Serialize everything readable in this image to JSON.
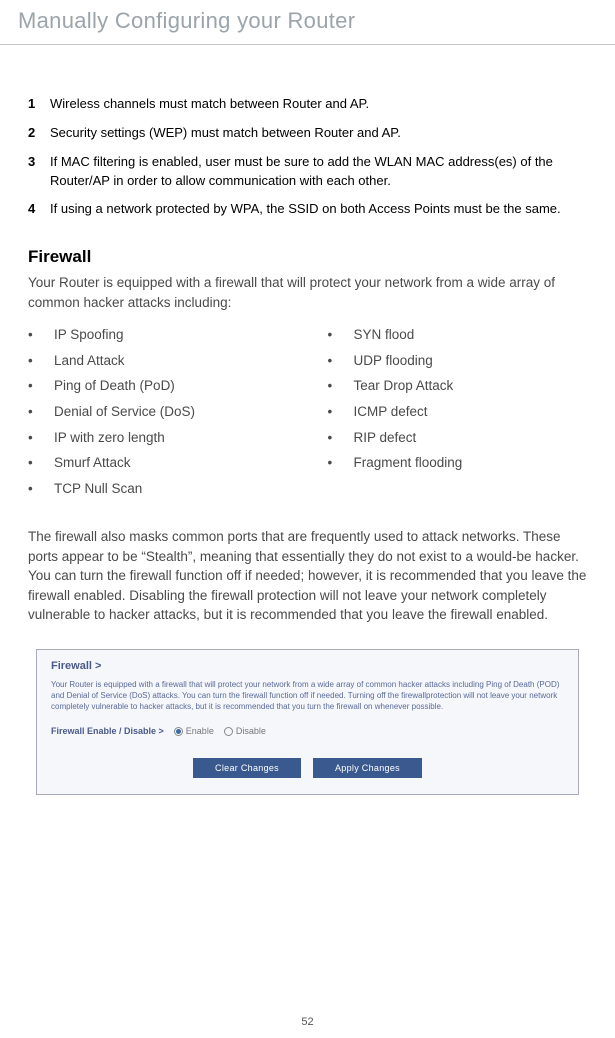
{
  "header": {
    "title": "Manually Configuring your Router"
  },
  "numbered": [
    {
      "num": "1",
      "text": "Wireless channels must match between Router and AP."
    },
    {
      "num": "2",
      "text": "Security settings (WEP) must match between Router and AP."
    },
    {
      "num": "3",
      "text": "If MAC filtering is enabled, user must be sure to add the WLAN MAC address(es) of the Router/AP in order to allow communication with each other."
    },
    {
      "num": "4",
      "text": "If using a network protected by WPA, the SSID on both Access Points must be the same."
    }
  ],
  "firewall": {
    "title": "Firewall",
    "intro": "Your Router is equipped with a firewall that will protect your network from a wide array of common hacker attacks including:",
    "left_items": [
      "IP Spoofing",
      "Land Attack",
      "Ping of Death (PoD)",
      "Denial of Service (DoS)",
      "IP with zero length",
      "Smurf Attack",
      "TCP Null Scan"
    ],
    "right_items": [
      "SYN flood",
      "UDP flooding",
      "Tear Drop Attack",
      "ICMP defect",
      "RIP defect",
      "Fragment flooding"
    ],
    "paragraph": "The firewall also masks common ports that are frequently used to attack networks. These ports appear to be “Stealth”, meaning that essentially they do not exist to a would-be hacker. You can turn the firewall function off if needed; however, it is recommended that you leave the firewall enabled. Disabling the firewall protection will not leave your network completely vulnerable to hacker attacks, but it is recommended that you leave the firewall enabled."
  },
  "screenshot": {
    "heading": "Firewall >",
    "desc": "Your Router is equipped with a firewall that will protect your network from a wide array of common hacker attacks including Ping of Death (POD) and Denial of Service (DoS) attacks. You can turn the firewall function off if needed. Turning off the firewallprotection will not leave your network completely vulnerable to hacker attacks, but it is recommended that you turn the firewall on whenever possible.",
    "row_label": "Firewall Enable / Disable >",
    "enable_label": "Enable",
    "disable_label": "Disable",
    "btn_clear": "Clear Changes",
    "btn_apply": "Apply Changes"
  },
  "page_number": "52"
}
